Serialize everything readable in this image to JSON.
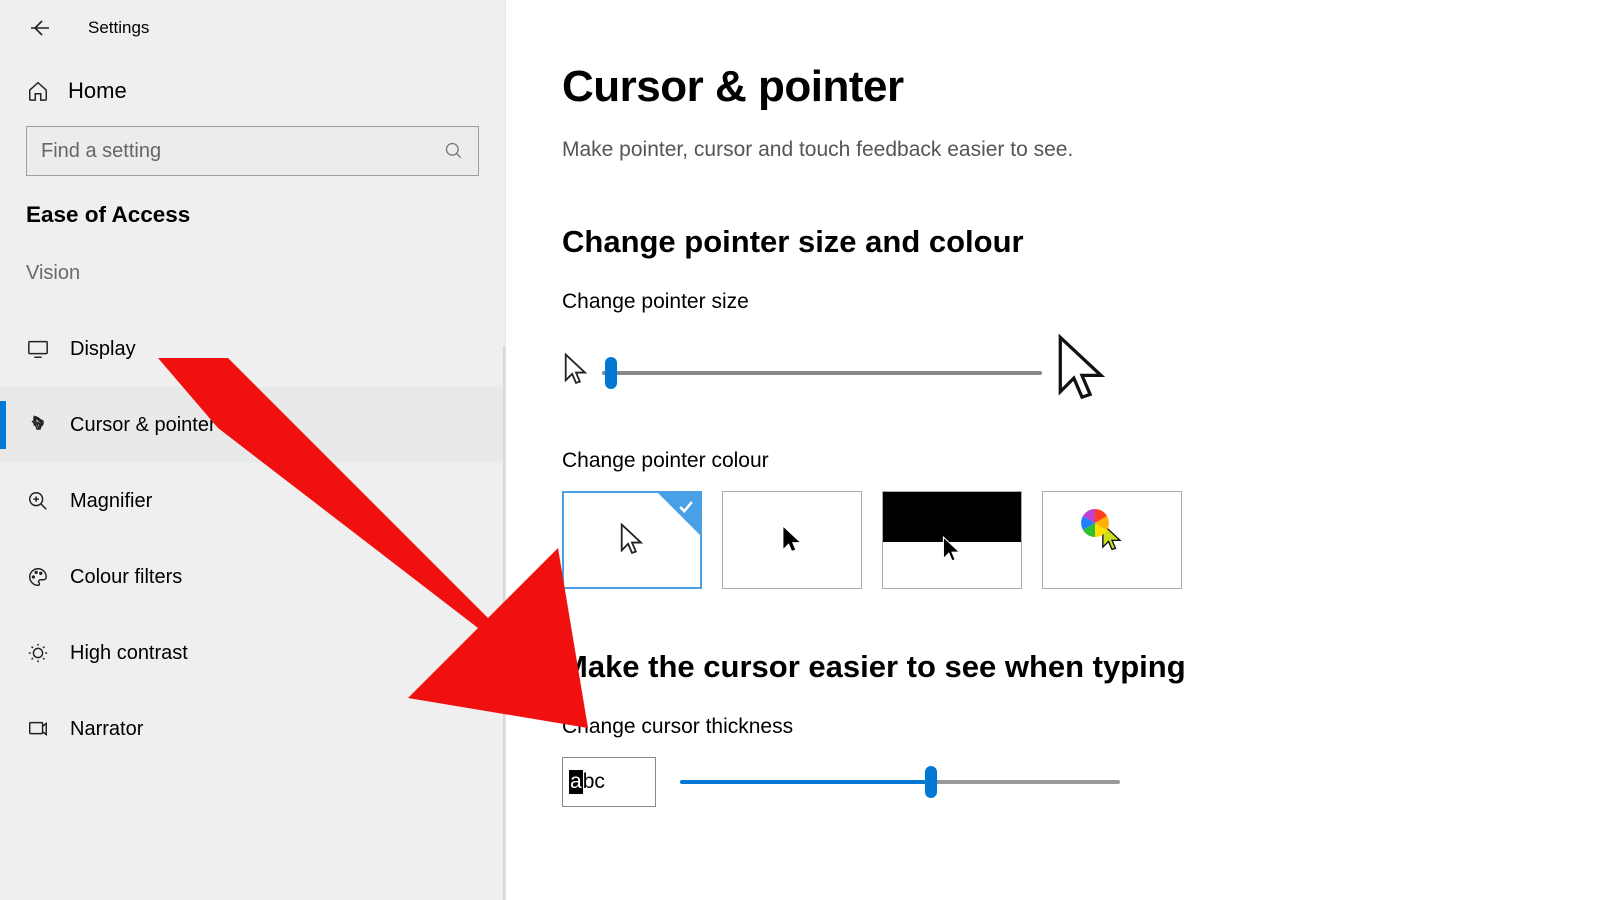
{
  "header": {
    "app_title": "Settings"
  },
  "sidebar": {
    "home_label": "Home",
    "search_placeholder": "Find a setting",
    "category": "Ease of Access",
    "group": "Vision",
    "items": [
      {
        "label": "Display",
        "icon": "display-icon"
      },
      {
        "label": "Cursor & pointer",
        "icon": "pointer-icon"
      },
      {
        "label": "Magnifier",
        "icon": "magnifier-icon"
      },
      {
        "label": "Colour filters",
        "icon": "palette-icon"
      },
      {
        "label": "High contrast",
        "icon": "contrast-icon"
      },
      {
        "label": "Narrator",
        "icon": "narrator-icon"
      }
    ],
    "active_index": 1
  },
  "main": {
    "title": "Cursor & pointer",
    "subtitle": "Make pointer, cursor and touch feedback easier to see.",
    "section1_title": "Change pointer size and colour",
    "size_label": "Change pointer size",
    "colour_label": "Change pointer colour",
    "section2_title": "Make the cursor easier to see when typing",
    "thickness_label": "Change cursor thickness",
    "abc_preview": "abc"
  },
  "controls": {
    "pointer_size_slider": {
      "min": 1,
      "max": 15,
      "value": 1,
      "percent": 2
    },
    "pointer_colour_selected": 0,
    "cursor_thickness_slider": {
      "min": 1,
      "max": 20,
      "value": 11,
      "percent": 57
    }
  }
}
